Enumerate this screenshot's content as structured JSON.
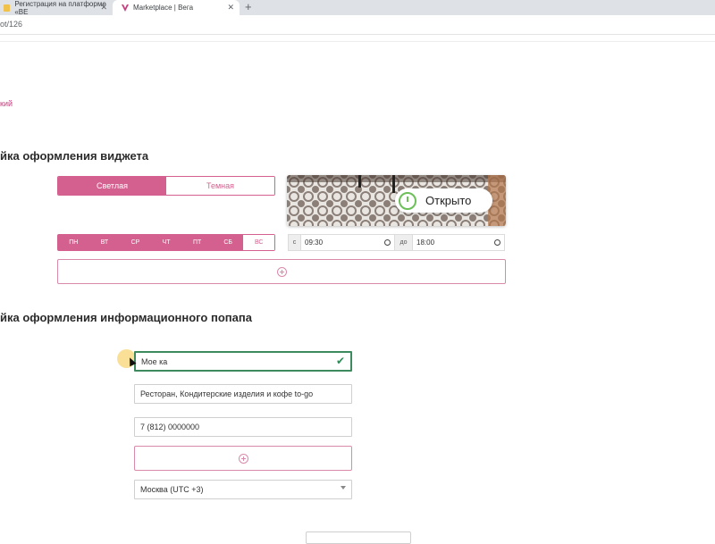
{
  "browser": {
    "tabs": [
      {
        "title": "Регистрация на платформе «ВЕ",
        "active": false
      },
      {
        "title": "Marketplace | Вега",
        "active": true
      }
    ],
    "new_tab_icon": "plus-icon",
    "url_fragment": "ot/126"
  },
  "page": {
    "link_text": "кий",
    "widget_section": {
      "title": "йка оформления виджета",
      "theme_light": "Светлая",
      "theme_dark": "Темная",
      "selected_theme": "Светлая",
      "days": [
        "ПН",
        "ВТ",
        "СР",
        "ЧТ",
        "ПТ",
        "СБ",
        "ВС"
      ],
      "days_inactive": [
        "ВС"
      ],
      "preview_badge": "Открыто",
      "time_from_prefix": "с",
      "time_from": "09:30",
      "time_to_prefix": "до",
      "time_to": "18:00"
    },
    "popup_section": {
      "title": "йка оформления информационного попапа",
      "name_value": "Мое ка",
      "category_value": "Ресторан, Кондитерские изделия и кофе to-go",
      "phone_value": "7 (812) 0000000",
      "timezone_value": "Москва (UTC +3)"
    }
  },
  "colors": {
    "accent": "#d4608f",
    "success": "#2e8b57",
    "open_green": "#6cbf59"
  }
}
